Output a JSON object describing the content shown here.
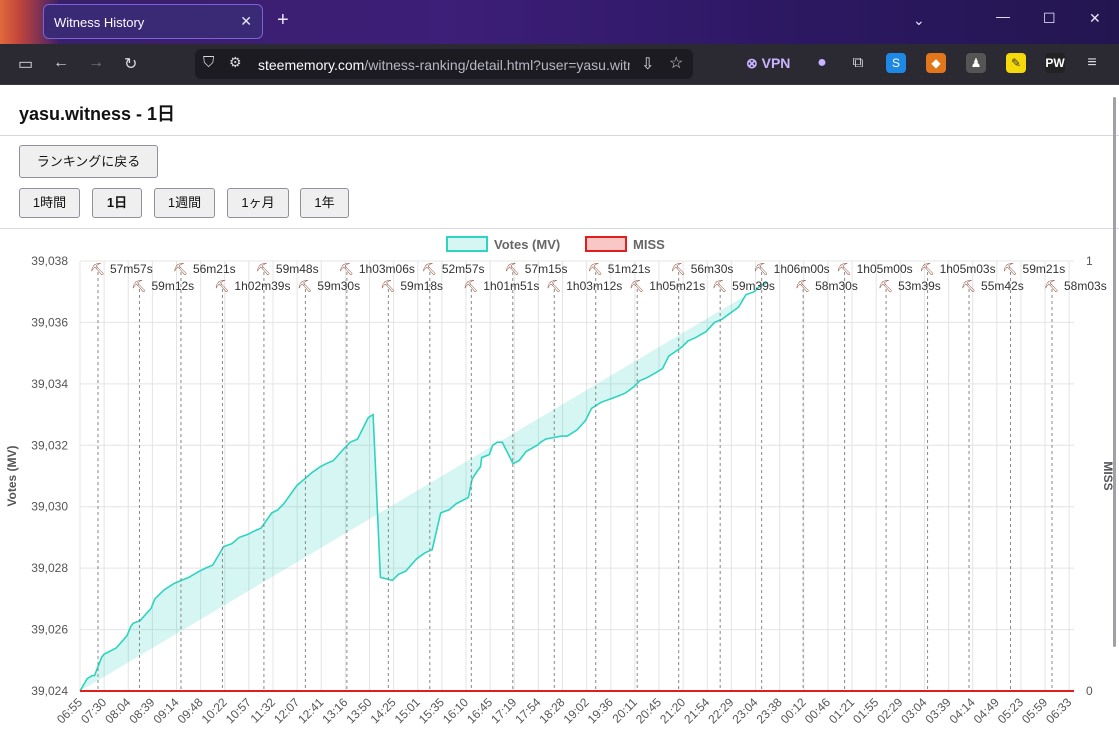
{
  "browser": {
    "tab_title": "Witness History",
    "url_host": "steememory.com",
    "url_path": "/witness-ranking/detail.html?user=yasu.witn",
    "vpn_label": "VPN"
  },
  "page": {
    "title": "yasu.witness - 1日",
    "back_button": "ランキングに戻る",
    "range_buttons": [
      "1時間",
      "1日",
      "1週間",
      "1ヶ月",
      "1年"
    ],
    "active_range": "1日"
  },
  "chart_data": {
    "type": "area",
    "legend": [
      {
        "name": "Votes (MV)",
        "color": "#2dd4bf"
      },
      {
        "name": "MISS",
        "color": "#e11d1d"
      }
    ],
    "ylabel_left": "Votes (MV)",
    "ylabel_right": "MISS",
    "ylim_left": [
      39024,
      39038
    ],
    "yticks_left": [
      "39,024",
      "39,026",
      "39,028",
      "39,030",
      "39,032",
      "39,034",
      "39,036",
      "39,038"
    ],
    "yticks_right": [
      "0",
      "1"
    ],
    "xticks": [
      "06:55",
      "07:30",
      "08:04",
      "08:39",
      "09:14",
      "09:48",
      "10:22",
      "10:57",
      "11:32",
      "12:07",
      "12:41",
      "13:16",
      "13:50",
      "14:25",
      "15:01",
      "15:35",
      "16:10",
      "16:45",
      "17:19",
      "17:54",
      "18:28",
      "19:02",
      "19:36",
      "20:11",
      "20:45",
      "21:20",
      "21:54",
      "22:29",
      "23:04",
      "23:38",
      "00:12",
      "00:46",
      "01:21",
      "01:55",
      "02:29",
      "03:04",
      "03:39",
      "04:14",
      "04:49",
      "05:23",
      "05:59",
      "06:33"
    ],
    "grid": true,
    "block_annotations": [
      "57m57s",
      "59m12s",
      "56m21s",
      "1h02m39s",
      "59m48s",
      "59m30s",
      "1h03m06s",
      "59m18s",
      "52m57s",
      "1h01m51s",
      "57m15s",
      "1h03m12s",
      "51m21s",
      "1h05m21s",
      "56m30s",
      "59m39s",
      "1h06m00s",
      "58m30s",
      "1h05m00s",
      "53m39s",
      "1h05m03s",
      "55m42s",
      "59m21s",
      "58m03s"
    ],
    "votes_series": {
      "name": "Votes (MV)",
      "x_index": [
        0,
        0.3,
        0.5,
        0.6,
        0.9,
        1,
        1.5,
        1.95,
        2.1,
        2.2,
        2.5,
        2.95,
        3.1,
        3.5,
        3.9,
        4.2,
        4.5,
        4.95,
        5.2,
        5.5,
        5.95,
        6.3,
        6.6,
        6.95,
        7.2,
        7.5,
        7.95,
        8.2,
        8.45,
        9,
        9.3,
        9.6,
        9.95,
        10.2,
        10.5,
        10.95,
        11.2,
        11.5,
        11.95,
        12.15,
        12.45,
        12.95,
        13.2,
        13.5,
        13.95,
        14.3,
        14.6,
        14.95,
        15.3,
        15.6,
        16.1,
        16.15,
        16.25,
        16.5,
        16.6,
        16.65,
        16.97,
        17.1,
        17.3,
        17.5,
        17.95,
        18.2,
        18.5,
        18.95,
        19.1,
        19.3,
        19.95,
        20.2,
        20.6,
        20.95,
        21.2,
        21.6,
        21.95,
        22.3,
        22.6,
        22.95,
        23.2,
        23.5,
        23.95,
        24.15,
        24.4,
        24.95,
        25.2,
        25.5,
        25.95,
        26.3,
        26.6,
        26.95,
        27.3,
        27.6,
        27.95,
        28.2,
        28.5,
        28.95,
        29.2,
        29.5,
        29.95,
        30.2,
        30.6,
        30.95,
        31.3,
        31.6,
        31.95,
        32.2,
        32.6,
        32.95,
        33.3,
        33.6,
        33.95,
        34.2,
        34.6,
        34.95,
        35.2,
        35.6,
        35.95,
        36.2,
        36.6,
        36.95,
        37.2,
        37.6,
        37.95,
        38.3,
        38.6,
        38.95,
        39.2,
        39.6,
        39.95,
        40.2,
        40.6,
        41,
        41.5
      ],
      "values": [
        39024,
        39024.4,
        39024.5,
        39024.5,
        39025.1,
        39025.2,
        39025.4,
        39025.8,
        39026.1,
        39026.2,
        39026.3,
        39026.7,
        39027,
        39027.3,
        39027.5,
        39027.6,
        39027.7,
        39027.9,
        39028,
        39028.1,
        39028.7,
        39028.8,
        39029,
        39029.1,
        39029.2,
        39029.3,
        39029.8,
        39029.9,
        39030.1,
        39030.7,
        39030.9,
        39031.1,
        39031.3,
        39031.4,
        39031.5,
        39031.9,
        39032.1,
        39032.2,
        39032.9,
        39033,
        39027.7,
        39027.6,
        39027.8,
        39027.9,
        39028.3,
        39028.5,
        39028.6,
        39029.8,
        39029.9,
        39030.1,
        39030.3,
        39030.5,
        39030.9,
        39031.2,
        39031.3,
        39031.6,
        39031.7,
        39032,
        39032.1,
        39032.1,
        39031.4,
        39031.5,
        39031.8,
        39032,
        39032.1,
        39032.2,
        39032.3,
        39032.3,
        39032.5,
        39032.8,
        39033.2,
        39033.4,
        39033.5,
        39033.6,
        39033.7,
        39033.9,
        39034.1,
        39034.2,
        39034.4,
        39034.5,
        39034.9,
        39035.2,
        39035.4,
        39035.5,
        39035.7,
        39036,
        39036.1,
        39036.3,
        39036.5,
        39036.9,
        39037,
        39037.2,
        39037.3
      ]
    },
    "miss_series": {
      "name": "MISS",
      "value": 0
    }
  }
}
